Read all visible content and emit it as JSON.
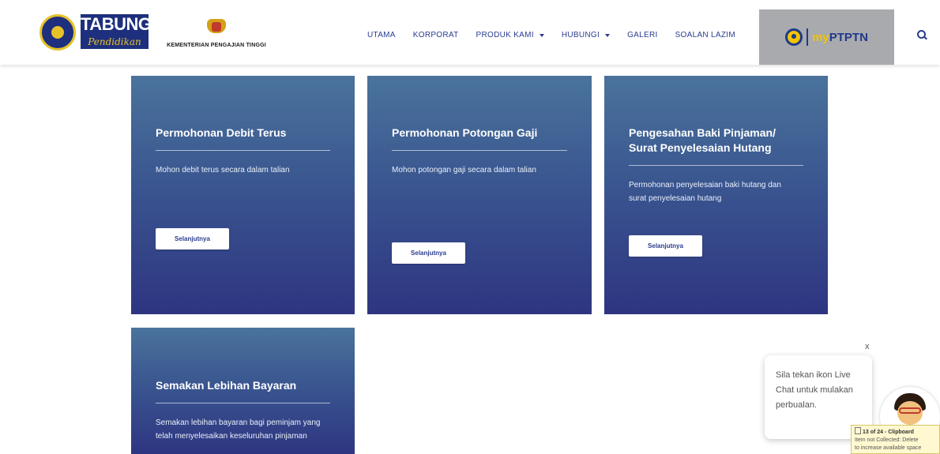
{
  "header": {
    "logo_tabung": "TABUNG",
    "logo_pendidikan": "Pendidikan",
    "ministry": "KEMENTERIAN PENGAJIAN TINGGI",
    "nav": [
      "UTAMA",
      "KORPORAT",
      "PRODUK KAMI",
      "HUBUNGI",
      "GALERI",
      "SOALAN LAZIM"
    ],
    "myptptn_my": "my",
    "myptptn_ptptn": "PTPTN"
  },
  "cards": [
    {
      "title": "Permohonan Debit Terus",
      "desc": "Mohon debit terus secara dalam talian",
      "button": "Selanjutnya"
    },
    {
      "title": "Permohonan Potongan Gaji",
      "desc": "Mohon potongan gaji secara dalam talian",
      "button": "Selanjutnya"
    },
    {
      "title": "Pengesahan Baki Pinjaman/ Surat Penyelesaian Hutang",
      "desc": "Permohonan penyelesaian baki hutang dan surat penyelesaian hutang",
      "button": "Selanjutnya"
    },
    {
      "title": "Semakan Lebihan Bayaran",
      "desc": "Semakan lebihan bayaran bagi peminjam yang telah menyelesaikan keseluruhan pinjaman"
    }
  ],
  "chat": {
    "close": "x",
    "message": "Sila tekan ikon Live Chat untuk mulakan perbualan."
  },
  "clipboard": {
    "title": "13 of 24 - Clipboard",
    "line1": "Item not Collected: Delete",
    "line2": "to increase available space"
  },
  "colors": {
    "brand_navy": "#1e2f7d",
    "nav_text": "#2a3d8f",
    "card_top": "#4a739c",
    "card_bottom": "#2e3581",
    "accent_yellow": "#f2c400"
  },
  "icons": [
    "search-icon",
    "seal-icon",
    "crest-icon",
    "p-icon",
    "caret-down-icon",
    "close-icon",
    "clipboard-icon"
  ]
}
